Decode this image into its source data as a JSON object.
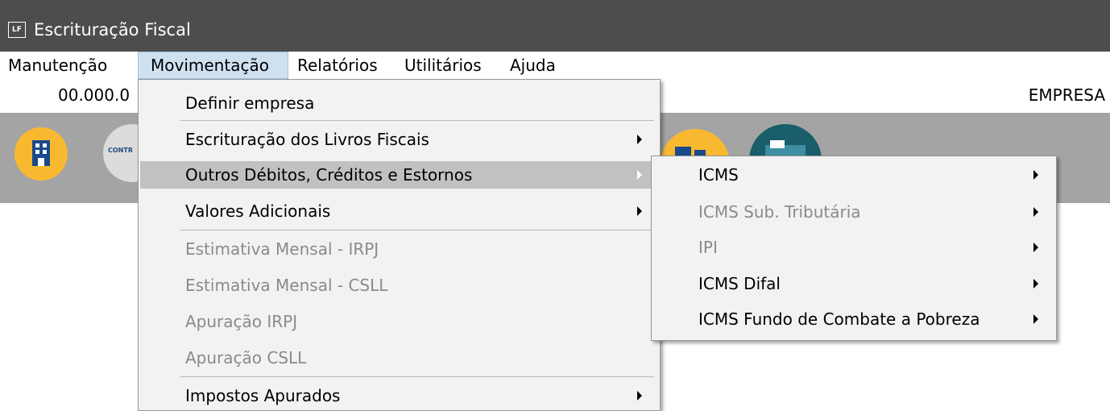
{
  "window": {
    "logo": "LF",
    "title": "Escrituração Fiscal"
  },
  "menubar": {
    "items": [
      {
        "label": "Manutenção"
      },
      {
        "label": "Movimentação"
      },
      {
        "label": "Relatórios"
      },
      {
        "label": "Utilitários"
      },
      {
        "label": "Ajuda"
      }
    ]
  },
  "infobar": {
    "cnpj": "00.000.0",
    "empresa": "EMPRESA"
  },
  "toolbar": {
    "contr_label": "CONTR"
  },
  "movimentacao_menu": {
    "items": [
      {
        "label": "Definir empresa",
        "enabled": true,
        "submenu": false
      },
      {
        "label": "Escrituração dos Livros Fiscais",
        "enabled": true,
        "submenu": true
      },
      {
        "label": "Outros Débitos, Créditos e Estornos",
        "enabled": true,
        "submenu": true,
        "highlighted": true
      },
      {
        "label": "Valores Adicionais",
        "enabled": true,
        "submenu": true
      },
      {
        "label": "Estimativa Mensal - IRPJ",
        "enabled": false,
        "submenu": false
      },
      {
        "label": "Estimativa Mensal - CSLL",
        "enabled": false,
        "submenu": false
      },
      {
        "label": "Apuração IRPJ",
        "enabled": false,
        "submenu": false
      },
      {
        "label": "Apuração CSLL",
        "enabled": false,
        "submenu": false
      },
      {
        "label": "Impostos Apurados",
        "enabled": true,
        "submenu": true
      }
    ]
  },
  "outros_submenu": {
    "items": [
      {
        "label": "ICMS",
        "enabled": true,
        "submenu": true
      },
      {
        "label": "ICMS Sub. Tributária",
        "enabled": false,
        "submenu": true
      },
      {
        "label": "IPI",
        "enabled": false,
        "submenu": true
      },
      {
        "label": "ICMS Difal",
        "enabled": true,
        "submenu": true
      },
      {
        "label": "ICMS Fundo de Combate a Pobreza",
        "enabled": true,
        "submenu": true
      }
    ]
  },
  "colors": {
    "titlebar": "#4d4d4d",
    "toolbar": "#a4a4a4",
    "menu_bg": "#f2f2f2",
    "highlight": "#c1c1c1",
    "open_menu": "#cfe0f1",
    "disabled_text": "#8a8a8a",
    "icon_orange": "#f8b931",
    "icon_teal": "#1a5d6b"
  }
}
